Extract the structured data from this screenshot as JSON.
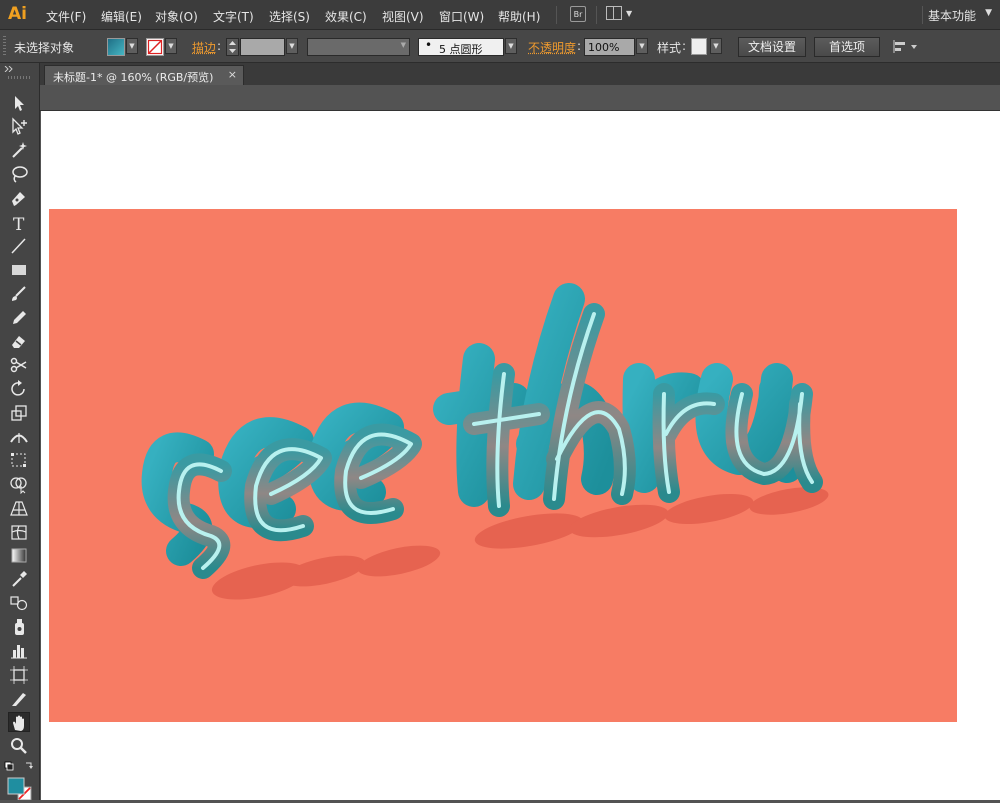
{
  "app": {
    "logo": "Ai"
  },
  "menu": {
    "items": [
      "文件(F)",
      "编辑(E)",
      "对象(O)",
      "文字(T)",
      "选择(S)",
      "效果(C)",
      "视图(V)",
      "窗口(W)",
      "帮助(H)"
    ],
    "bridge_label": "Br",
    "workspace": "基本功能"
  },
  "control": {
    "selection_status": "未选择对象",
    "stroke_label": "描边",
    "brush_value": "5 点圆形",
    "opacity_label": "不透明度",
    "opacity_value": "100%",
    "style_label": "样式",
    "doc_setup_button": "文档设置",
    "prefs_button": "首选项"
  },
  "document": {
    "tab_title": "未标题-1* @ 160% (RGB/预览)",
    "close_glyph": "×"
  },
  "artwork": {
    "text_left": "see",
    "text_right": "thru",
    "background_color": "#f77c64",
    "letter_side_color": "#2aa9b8",
    "letter_face_color": "#1b8c93",
    "outline_color": "#b8f1ef"
  },
  "tools": [
    "selection-tool",
    "direct-selection-tool",
    "magic-wand-tool",
    "lasso-tool",
    "pen-tool",
    "type-tool",
    "line-segment-tool",
    "rectangle-tool",
    "paintbrush-tool",
    "pencil-tool",
    "blob-brush-tool",
    "scissors-tool",
    "rotate-tool",
    "scale-tool",
    "width-tool",
    "free-transform-tool",
    "shape-builder-tool",
    "perspective-grid-tool",
    "mesh-tool",
    "gradient-tool",
    "eyedropper-tool",
    "blend-tool",
    "symbol-sprayer-tool",
    "column-graph-tool",
    "artboard-tool",
    "slice-tool",
    "hand-tool",
    "zoom-tool"
  ]
}
